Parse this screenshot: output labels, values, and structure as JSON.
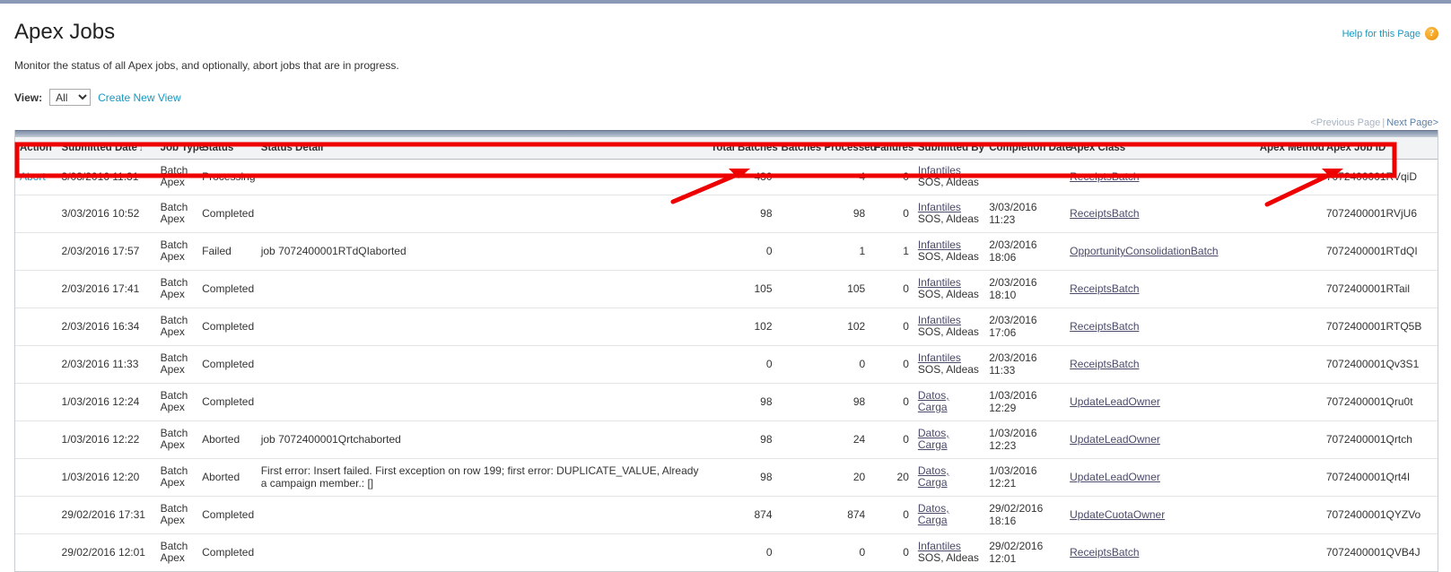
{
  "page": {
    "title": "Apex Jobs",
    "description": "Monitor the status of all Apex jobs, and optionally, abort jobs that are in progress.",
    "help_label": "Help for this Page",
    "help_icon_glyph": "?"
  },
  "view_bar": {
    "label": "View:",
    "selected": "All",
    "options": [
      "All"
    ],
    "create_view_label": "Create New View"
  },
  "pager": {
    "previous_label": "<Previous Page",
    "separator": "|",
    "next_label": "Next Page>"
  },
  "table": {
    "columns": [
      {
        "key": "action",
        "label": "Action",
        "align": "left"
      },
      {
        "key": "submitted_date",
        "label": "Submitted Date",
        "align": "left",
        "sort_indicator": "↓"
      },
      {
        "key": "job_type",
        "label": "Job Type",
        "align": "left"
      },
      {
        "key": "status",
        "label": "Status",
        "align": "left"
      },
      {
        "key": "status_detail",
        "label": "Status Detail",
        "align": "left"
      },
      {
        "key": "total_batches",
        "label": "Total Batches",
        "align": "right"
      },
      {
        "key": "batches_processed",
        "label": "Batches Processed",
        "align": "right"
      },
      {
        "key": "failures",
        "label": "Failures",
        "align": "right"
      },
      {
        "key": "submitted_by",
        "label": "Submitted By",
        "align": "left"
      },
      {
        "key": "completion_date",
        "label": "Completion Date",
        "align": "left"
      },
      {
        "key": "apex_class",
        "label": "Apex Class",
        "align": "left"
      },
      {
        "key": "apex_method",
        "label": "Apex Method",
        "align": "left"
      },
      {
        "key": "apex_job_id",
        "label": "Apex Job ID",
        "align": "left"
      }
    ],
    "rows": [
      {
        "action": "Abort",
        "submitted_date": "3/03/2016 11:31",
        "job_type_line1": "Batch",
        "job_type_line2": "Apex",
        "status": "Processing",
        "status_detail": "",
        "total_batches": "430",
        "batches_processed": "4",
        "failures": "0",
        "submitted_by_line1": "Infantiles",
        "submitted_by_line2": "SOS, Aldeas",
        "completion_date": "",
        "apex_class": "ReceiptsBatch",
        "apex_method": "",
        "apex_job_id": "7072400001RVqiD"
      },
      {
        "action": "",
        "submitted_date": "3/03/2016 10:52",
        "job_type_line1": "Batch",
        "job_type_line2": "Apex",
        "status": "Completed",
        "status_detail": "",
        "total_batches": "98",
        "batches_processed": "98",
        "failures": "0",
        "submitted_by_line1": "Infantiles",
        "submitted_by_line2": "SOS, Aldeas",
        "completion_date": "3/03/2016 11:23",
        "apex_class": "ReceiptsBatch",
        "apex_method": "",
        "apex_job_id": "7072400001RVjU6"
      },
      {
        "action": "",
        "submitted_date": "2/03/2016 17:57",
        "job_type_line1": "Batch",
        "job_type_line2": "Apex",
        "status": "Failed",
        "status_detail": "job 7072400001RTdQIaborted",
        "total_batches": "0",
        "batches_processed": "1",
        "failures": "1",
        "submitted_by_line1": "Infantiles",
        "submitted_by_line2": "SOS, Aldeas",
        "completion_date": "2/03/2016 18:06",
        "apex_class": "OpportunityConsolidationBatch",
        "apex_method": "",
        "apex_job_id": "7072400001RTdQI"
      },
      {
        "action": "",
        "submitted_date": "2/03/2016 17:41",
        "job_type_line1": "Batch",
        "job_type_line2": "Apex",
        "status": "Completed",
        "status_detail": "",
        "total_batches": "105",
        "batches_processed": "105",
        "failures": "0",
        "submitted_by_line1": "Infantiles",
        "submitted_by_line2": "SOS, Aldeas",
        "completion_date": "2/03/2016 18:10",
        "apex_class": "ReceiptsBatch",
        "apex_method": "",
        "apex_job_id": "7072400001RTail"
      },
      {
        "action": "",
        "submitted_date": "2/03/2016 16:34",
        "job_type_line1": "Batch",
        "job_type_line2": "Apex",
        "status": "Completed",
        "status_detail": "",
        "total_batches": "102",
        "batches_processed": "102",
        "failures": "0",
        "submitted_by_line1": "Infantiles",
        "submitted_by_line2": "SOS, Aldeas",
        "completion_date": "2/03/2016 17:06",
        "apex_class": "ReceiptsBatch",
        "apex_method": "",
        "apex_job_id": "7072400001RTQ5B"
      },
      {
        "action": "",
        "submitted_date": "2/03/2016 11:33",
        "job_type_line1": "Batch",
        "job_type_line2": "Apex",
        "status": "Completed",
        "status_detail": "",
        "total_batches": "0",
        "batches_processed": "0",
        "failures": "0",
        "submitted_by_line1": "Infantiles",
        "submitted_by_line2": "SOS, Aldeas",
        "completion_date": "2/03/2016 11:33",
        "apex_class": "ReceiptsBatch",
        "apex_method": "",
        "apex_job_id": "7072400001Qv3S1"
      },
      {
        "action": "",
        "submitted_date": "1/03/2016 12:24",
        "job_type_line1": "Batch",
        "job_type_line2": "Apex",
        "status": "Completed",
        "status_detail": "",
        "total_batches": "98",
        "batches_processed": "98",
        "failures": "0",
        "submitted_by_line1": "Datos, Carga",
        "submitted_by_line2": "",
        "completion_date": "1/03/2016 12:29",
        "apex_class": "UpdateLeadOwner",
        "apex_method": "",
        "apex_job_id": "7072400001Qru0t"
      },
      {
        "action": "",
        "submitted_date": "1/03/2016 12:22",
        "job_type_line1": "Batch",
        "job_type_line2": "Apex",
        "status": "Aborted",
        "status_detail": "job 7072400001Qrtchaborted",
        "total_batches": "98",
        "batches_processed": "24",
        "failures": "0",
        "submitted_by_line1": "Datos, Carga",
        "submitted_by_line2": "",
        "completion_date": "1/03/2016 12:23",
        "apex_class": "UpdateLeadOwner",
        "apex_method": "",
        "apex_job_id": "7072400001Qrtch"
      },
      {
        "action": "",
        "submitted_date": "1/03/2016 12:20",
        "job_type_line1": "Batch",
        "job_type_line2": "Apex",
        "status": "Aborted",
        "status_detail": "First error: Insert failed. First exception on row 199; first error: DUPLICATE_VALUE, Already a campaign member.: []",
        "total_batches": "98",
        "batches_processed": "20",
        "failures": "20",
        "submitted_by_line1": "Datos, Carga",
        "submitted_by_line2": "",
        "completion_date": "1/03/2016 12:21",
        "apex_class": "UpdateLeadOwner",
        "apex_method": "",
        "apex_job_id": "7072400001Qrt4I"
      },
      {
        "action": "",
        "submitted_date": "29/02/2016 17:31",
        "job_type_line1": "Batch",
        "job_type_line2": "Apex",
        "status": "Completed",
        "status_detail": "",
        "total_batches": "874",
        "batches_processed": "874",
        "failures": "0",
        "submitted_by_line1": "Datos, Carga",
        "submitted_by_line2": "",
        "completion_date": "29/02/2016 18:16",
        "apex_class": "UpdateCuotaOwner",
        "apex_method": "",
        "apex_job_id": "7072400001QYZVo"
      },
      {
        "action": "",
        "submitted_date": "29/02/2016 12:01",
        "job_type_line1": "Batch",
        "job_type_line2": "Apex",
        "status": "Completed",
        "status_detail": "",
        "total_batches": "0",
        "batches_processed": "0",
        "failures": "0",
        "submitted_by_line1": "Infantiles",
        "submitted_by_line2": "SOS, Aldeas",
        "completion_date": "29/02/2016 12:01",
        "apex_class": "ReceiptsBatch",
        "apex_method": "",
        "apex_job_id": "7072400001QVB4J"
      }
    ]
  },
  "annotations": {
    "highlight_color": "#ee0000",
    "highlight_row_index": 0,
    "arrow_1_target": "430",
    "arrow_2_target": "7072400001RVqiD"
  }
}
